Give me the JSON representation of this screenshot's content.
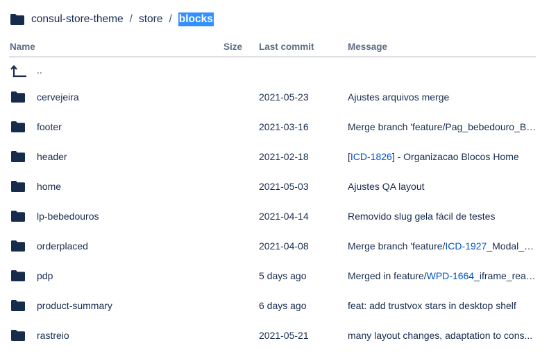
{
  "breadcrumb": {
    "repo": "consul-store-theme",
    "sep1": "/",
    "folder": "store",
    "sep2": "/",
    "current": "blocks"
  },
  "table": {
    "headers": {
      "name": "Name",
      "size": "Size",
      "last_commit": "Last commit",
      "message": "Message"
    },
    "parent": {
      "name": "..",
      "icon": "arrow-up-left-icon"
    },
    "rows": [
      {
        "name": "cervejeira",
        "last_commit": "2021-05-23",
        "message": {
          "before": "Ajustes arquivos merge",
          "link": "",
          "after": ""
        }
      },
      {
        "name": "footer",
        "last_commit": "2021-03-16",
        "message": {
          "before": "Merge branch 'feature/Pag_bebedouro_Ba...",
          "link": "",
          "after": ""
        }
      },
      {
        "name": "header",
        "last_commit": "2021-02-18",
        "message": {
          "before": "[",
          "link": "ICD-1826",
          "after": "] - Organizacao Blocos Home"
        }
      },
      {
        "name": "home",
        "last_commit": "2021-05-03",
        "message": {
          "before": "Ajustes QA layout",
          "link": "",
          "after": ""
        }
      },
      {
        "name": "lp-bebedouros",
        "last_commit": "2021-04-14",
        "message": {
          "before": "Removido slug gela fácil de testes",
          "link": "",
          "after": ""
        }
      },
      {
        "name": "orderplaced",
        "last_commit": "2021-04-08",
        "message": {
          "before": "Merge branch 'feature/",
          "link": "ICD-1927",
          "after": "_Modal_C..."
        }
      },
      {
        "name": "pdp",
        "last_commit": "5 days ago",
        "message": {
          "before": "Merged in feature/",
          "link": "WPD-1664",
          "after": "_iframe_reali..."
        }
      },
      {
        "name": "product-summary",
        "last_commit": "6 days ago",
        "message": {
          "before": "feat: add trustvox stars in desktop shelf",
          "link": "",
          "after": ""
        }
      },
      {
        "name": "rastreio",
        "last_commit": "2021-05-21",
        "message": {
          "before": "many layout changes, adaptation to cons...",
          "link": "",
          "after": ""
        }
      }
    ],
    "row_icon": "folder-icon"
  },
  "colors": {
    "text": "#172b4d",
    "header_text": "#5e6c84",
    "link": "#0052cc",
    "selection": "#3390ff",
    "icon": "#172b4d",
    "divider": "#dfe1e6"
  }
}
